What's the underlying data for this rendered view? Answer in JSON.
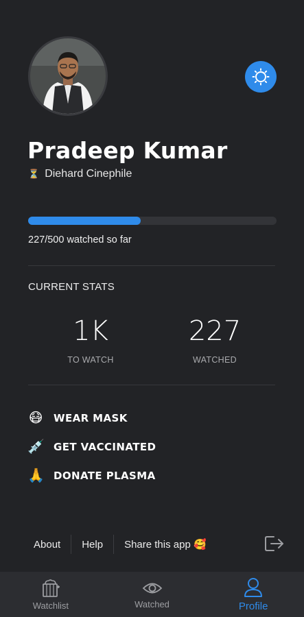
{
  "profile": {
    "name": "Pradeep Kumar",
    "rank_icon": "medal-icon",
    "rank_title": "Diehard Cinephile"
  },
  "progress": {
    "watched": 227,
    "goal": 500,
    "fraction": 0.454,
    "text": "227/500 watched so far"
  },
  "stats": {
    "title": "CURRENT STATS",
    "items": [
      {
        "value": "1K",
        "label": "TO WATCH"
      },
      {
        "value": "227",
        "label": "WATCHED"
      }
    ]
  },
  "actions": [
    {
      "emoji": "😷",
      "label": "WEAR MASK"
    },
    {
      "emoji": "💉",
      "label": "GET VACCINATED"
    },
    {
      "emoji": "🙏",
      "label": "DONATE PLASMA"
    }
  ],
  "footer": {
    "about": "About",
    "help": "Help",
    "share": "Share this app 🥰"
  },
  "nav": [
    {
      "label": "Watchlist",
      "icon": "watchlist-icon",
      "active": false
    },
    {
      "label": "Watched",
      "icon": "eye-icon",
      "active": false
    },
    {
      "label": "Profile",
      "icon": "profile-icon",
      "active": true
    }
  ],
  "colors": {
    "background": "#222326",
    "accent": "#2f8bea",
    "nav_background": "#2c2d31"
  }
}
